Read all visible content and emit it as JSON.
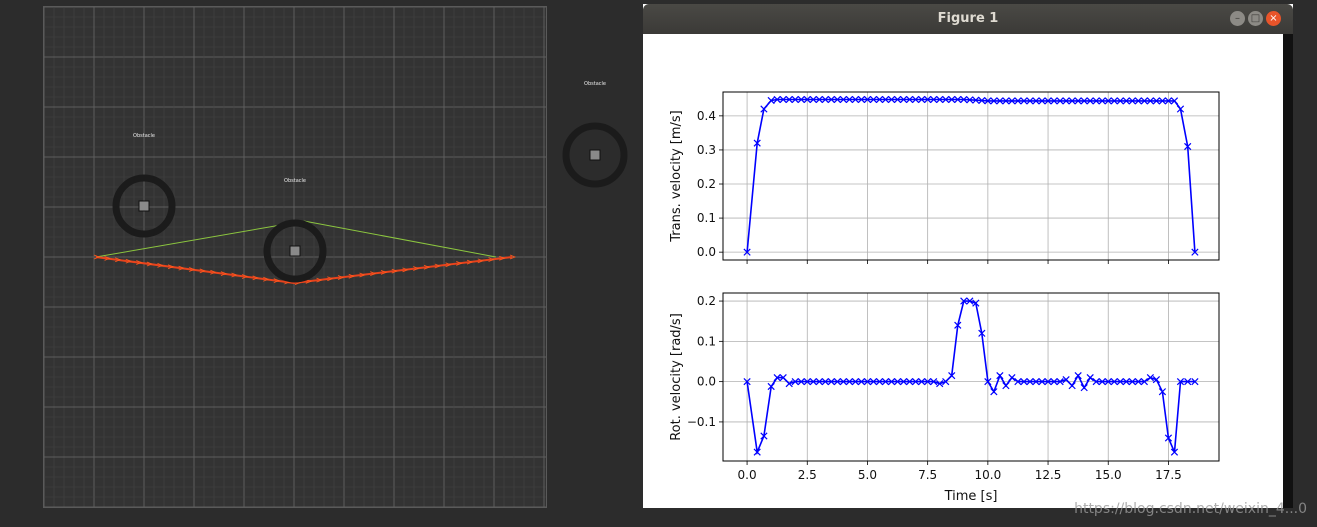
{
  "figure_window": {
    "title": "Figure 1",
    "buttons": {
      "minimize": "–",
      "maximize": "□",
      "close": "×"
    }
  },
  "simulation": {
    "obstacle_labels": [
      "Obstacle",
      "Obstacle",
      "Obstacle"
    ]
  },
  "chart_data": [
    {
      "type": "line",
      "title": "",
      "xlabel": "",
      "ylabel": "Trans. velocity [m/s]",
      "xlim": [
        -1,
        19.6
      ],
      "ylim": [
        -0.023,
        0.47
      ],
      "xticks": [
        0.0,
        2.5,
        5.0,
        7.5,
        10.0,
        12.5,
        15.0,
        17.5
      ],
      "show_xticklabels": false,
      "yticks": [
        0.0,
        0.1,
        0.2,
        0.3,
        0.4
      ],
      "yticklabels": [
        "0.0",
        "0.1",
        "0.2",
        "0.3",
        "0.4"
      ],
      "grid": true,
      "color": "#0000ff",
      "marker": "x",
      "x": [
        0.0,
        0.42,
        0.7,
        1.0,
        1.25,
        1.5,
        1.75,
        2.0,
        2.25,
        2.5,
        2.75,
        3.0,
        3.25,
        3.5,
        3.75,
        4.0,
        4.25,
        4.5,
        4.75,
        5.0,
        5.25,
        5.5,
        5.75,
        6.0,
        6.25,
        6.5,
        6.75,
        7.0,
        7.25,
        7.5,
        7.75,
        8.0,
        8.25,
        8.5,
        8.75,
        9.0,
        9.25,
        9.5,
        9.75,
        10.0,
        10.25,
        10.5,
        10.75,
        11.0,
        11.25,
        11.5,
        11.75,
        12.0,
        12.25,
        12.5,
        12.75,
        13.0,
        13.25,
        13.5,
        13.75,
        14.0,
        14.25,
        14.5,
        14.75,
        15.0,
        15.25,
        15.5,
        15.75,
        16.0,
        16.25,
        16.5,
        16.75,
        17.0,
        17.25,
        17.5,
        17.75,
        18.0,
        18.3,
        18.6
      ],
      "y": [
        0.0,
        0.32,
        0.42,
        0.445,
        0.448,
        0.448,
        0.448,
        0.448,
        0.448,
        0.448,
        0.448,
        0.448,
        0.448,
        0.448,
        0.448,
        0.448,
        0.448,
        0.448,
        0.448,
        0.448,
        0.448,
        0.448,
        0.448,
        0.448,
        0.448,
        0.448,
        0.448,
        0.448,
        0.448,
        0.448,
        0.448,
        0.448,
        0.448,
        0.448,
        0.448,
        0.448,
        0.447,
        0.446,
        0.445,
        0.444,
        0.444,
        0.444,
        0.444,
        0.444,
        0.444,
        0.444,
        0.444,
        0.444,
        0.444,
        0.444,
        0.444,
        0.444,
        0.444,
        0.444,
        0.444,
        0.444,
        0.444,
        0.444,
        0.444,
        0.444,
        0.444,
        0.444,
        0.444,
        0.444,
        0.444,
        0.444,
        0.444,
        0.444,
        0.444,
        0.444,
        0.444,
        0.42,
        0.31,
        0.0
      ]
    },
    {
      "type": "line",
      "title": "",
      "xlabel": "Time [s]",
      "ylabel": "Rot. velocity [rad/s]",
      "xlim": [
        -1,
        19.6
      ],
      "ylim": [
        -0.197,
        0.22
      ],
      "xticks": [
        0.0,
        2.5,
        5.0,
        7.5,
        10.0,
        12.5,
        15.0,
        17.5
      ],
      "xticklabels": [
        "0.0",
        "2.5",
        "5.0",
        "7.5",
        "10.0",
        "12.5",
        "15.0",
        "17.5"
      ],
      "show_xticklabels": true,
      "yticks": [
        -0.1,
        0.0,
        0.1,
        0.2
      ],
      "yticklabels": [
        "−0.1",
        "0.0",
        "0.1",
        "0.2"
      ],
      "grid": true,
      "color": "#0000ff",
      "marker": "x",
      "x": [
        0.0,
        0.42,
        0.7,
        1.0,
        1.25,
        1.5,
        1.75,
        2.0,
        2.25,
        2.5,
        2.75,
        3.0,
        3.25,
        3.5,
        3.75,
        4.0,
        4.25,
        4.5,
        4.75,
        5.0,
        5.25,
        5.5,
        5.75,
        6.0,
        6.25,
        6.5,
        6.75,
        7.0,
        7.25,
        7.5,
        7.75,
        8.0,
        8.25,
        8.5,
        8.75,
        9.0,
        9.25,
        9.5,
        9.75,
        10.0,
        10.25,
        10.5,
        10.75,
        11.0,
        11.25,
        11.5,
        11.75,
        12.0,
        12.25,
        12.5,
        12.75,
        13.0,
        13.25,
        13.5,
        13.75,
        14.0,
        14.25,
        14.5,
        14.75,
        15.0,
        15.25,
        15.5,
        15.75,
        16.0,
        16.25,
        16.5,
        16.75,
        17.0,
        17.25,
        17.5,
        17.75,
        18.0,
        18.3,
        18.6
      ],
      "y": [
        0.0,
        -0.175,
        -0.135,
        -0.012,
        0.01,
        0.01,
        -0.005,
        0.0,
        0.0,
        0.0,
        0.0,
        0.0,
        0.0,
        0.0,
        0.0,
        0.0,
        0.0,
        0.0,
        0.0,
        0.0,
        0.0,
        0.0,
        0.0,
        0.0,
        0.0,
        0.0,
        0.0,
        0.0,
        0.0,
        0.0,
        0.0,
        -0.005,
        0.0,
        0.015,
        0.14,
        0.2,
        0.2,
        0.195,
        0.12,
        0.0,
        -0.025,
        0.015,
        -0.01,
        0.01,
        0.0,
        0.0,
        0.0,
        0.0,
        0.0,
        0.0,
        0.0,
        0.0,
        0.005,
        -0.01,
        0.015,
        -0.015,
        0.01,
        0.0,
        0.0,
        0.0,
        0.0,
        0.0,
        0.0,
        0.0,
        0.0,
        0.0,
        0.01,
        0.005,
        -0.025,
        -0.14,
        -0.175,
        0.0,
        0.0,
        0.0
      ]
    }
  ],
  "watermark": "https://blog.csdn.net/weixin_4...0"
}
